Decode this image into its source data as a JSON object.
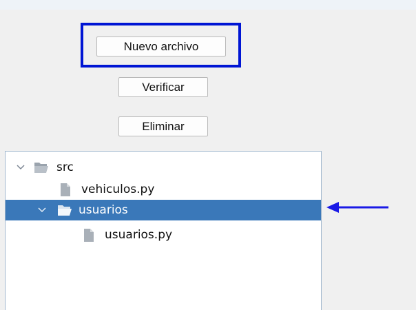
{
  "toolbar": {
    "new_file_label": "Nuevo archivo",
    "verify_label": "Verificar",
    "delete_label": "Eliminar"
  },
  "tree": {
    "items": [
      {
        "label": "src",
        "type": "folder",
        "expanded": true,
        "selected": false
      },
      {
        "label": "vehiculos.py",
        "type": "file",
        "selected": false
      },
      {
        "label": "usuarios",
        "type": "folder",
        "expanded": true,
        "selected": true
      },
      {
        "label": "usuarios.py",
        "type": "file",
        "selected": false
      }
    ]
  },
  "icons": {
    "chevron": "chevron-down-icon",
    "folder": "folder-open-icon",
    "file": "file-icon",
    "arrow": "arrow-left-icon"
  },
  "colors": {
    "highlight_box": "#0015d4",
    "selection": "#3a78b9",
    "arrow": "#1a1ae6"
  }
}
